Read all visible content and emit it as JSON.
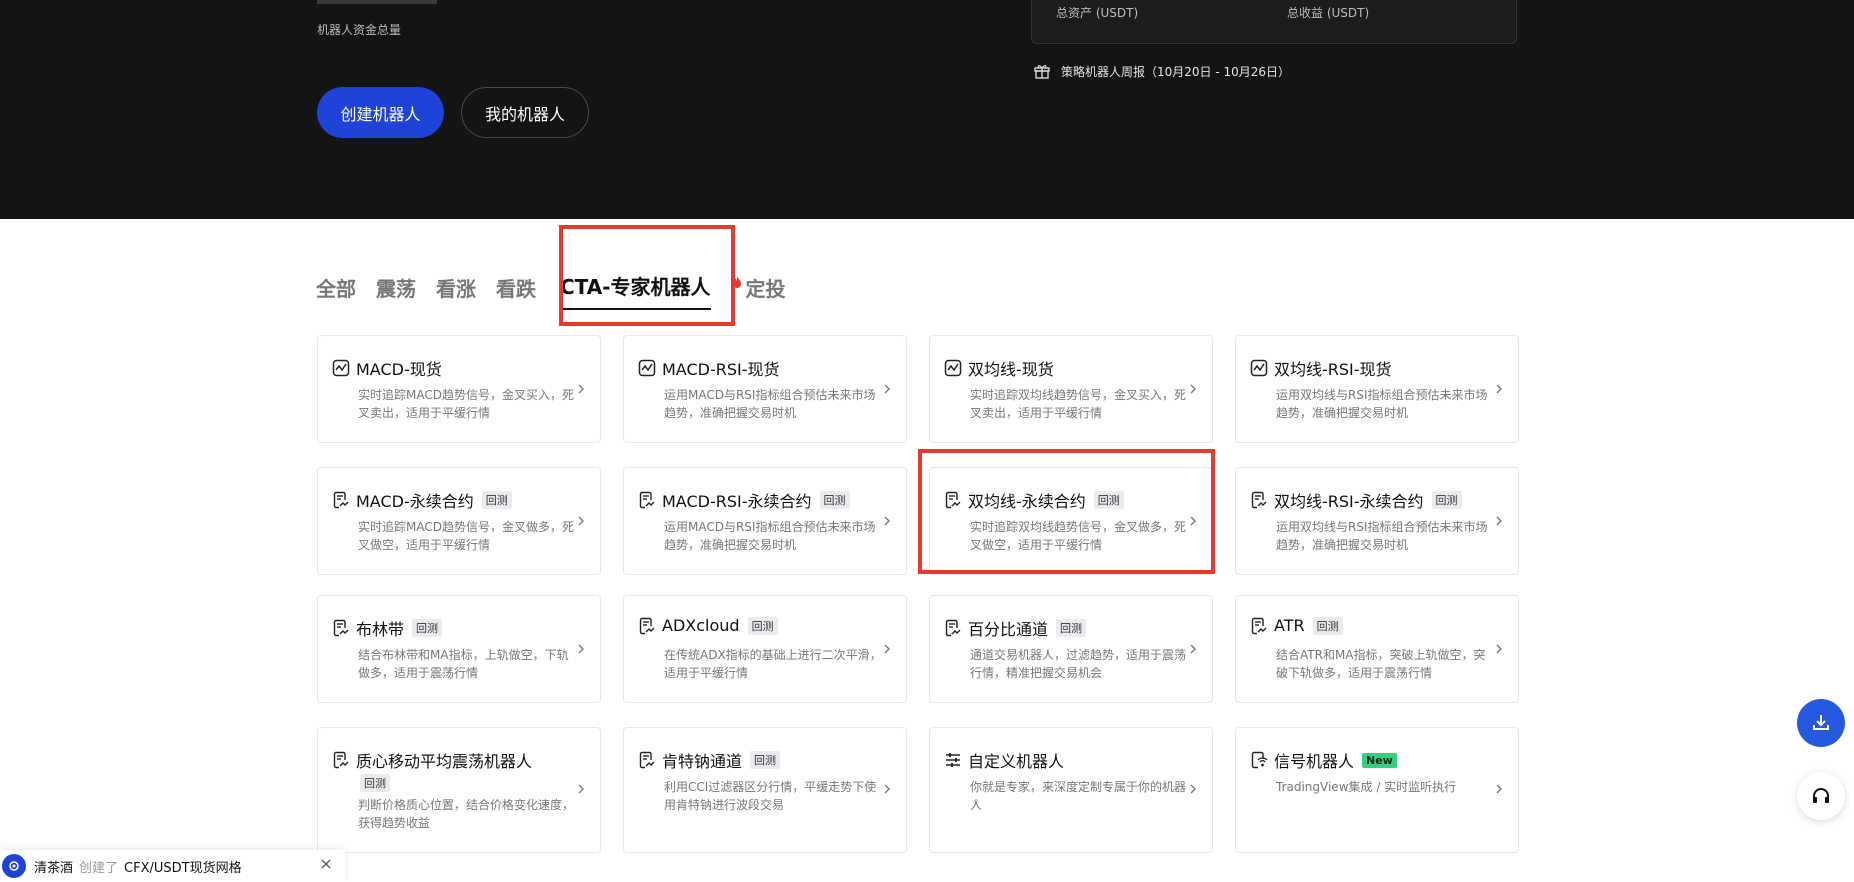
{
  "hero": {
    "label": "机器人资金总量",
    "create_button": "创建机器人",
    "my_bots_button": "我的机器人",
    "stats": {
      "total_assets_label": "总资产 (USDT)",
      "total_profit_label": "总收益 (USDT)"
    },
    "weekly_report": "策略机器人周报（10月20日 - 10月26日）"
  },
  "tabs": [
    {
      "label": "全部"
    },
    {
      "label": "震荡"
    },
    {
      "label": "看涨"
    },
    {
      "label": "看跌"
    },
    {
      "label": "CTA-专家机器人",
      "active": true
    },
    {
      "label": "定投",
      "icon": "fire-icon"
    }
  ],
  "cards": [
    {
      "title": "MACD-现货",
      "badge": "",
      "icon": "chart-line-icon",
      "desc": "实时追踪MACD趋势信号，金叉买入，死叉卖出，适用于平缓行情"
    },
    {
      "title": "MACD-RSI-现货",
      "badge": "",
      "icon": "chart-line-icon",
      "desc": "运用MACD与RSI指标组合预估未来市场趋势，准确把握交易时机"
    },
    {
      "title": "双均线-现货",
      "badge": "",
      "icon": "chart-line-icon",
      "desc": "实时追踪双均线趋势信号，金叉买入，死叉卖出，适用于平缓行情"
    },
    {
      "title": "双均线-RSI-现货",
      "badge": "",
      "icon": "chart-line-icon",
      "desc": "运用双均线与RSI指标组合预估未来市场趋势，准确把握交易时机"
    },
    {
      "title": "MACD-永续合约",
      "badge": "回测",
      "icon": "doc-chart-icon",
      "desc": "实时追踪MACD趋势信号，金叉做多，死叉做空，适用于平缓行情"
    },
    {
      "title": "MACD-RSI-永续合约",
      "badge": "回测",
      "icon": "doc-chart-icon",
      "desc": "运用MACD与RSI指标组合预估未来市场趋势，准确把握交易时机"
    },
    {
      "title": "双均线-永续合约",
      "badge": "回测",
      "icon": "doc-chart-icon",
      "desc": "实时追踪双均线趋势信号，金叉做多，死叉做空，适用于平缓行情"
    },
    {
      "title": "双均线-RSI-永续合约",
      "badge": "回测",
      "icon": "doc-chart-icon",
      "desc": "运用双均线与RSI指标组合预估未来市场趋势，准确把握交易时机"
    },
    {
      "title": "布林带",
      "badge": "回测",
      "icon": "doc-chart-icon",
      "desc": "结合布林带和MA指标，上轨做空，下轨做多，适用于震荡行情"
    },
    {
      "title": "ADXcloud",
      "badge": "回测",
      "icon": "doc-chart-icon",
      "desc": "在传统ADX指标的基础上进行二次平滑，适用于平缓行情"
    },
    {
      "title": "百分比通道",
      "badge": "回测",
      "icon": "doc-chart-icon",
      "desc": "通道交易机器人，过滤趋势，适用于震荡行情，精准把握交易机会"
    },
    {
      "title": "ATR",
      "badge": "回测",
      "icon": "doc-chart-icon",
      "desc": "结合ATR和MA指标，突破上轨做空，突破下轨做多，适用于震荡行情"
    },
    {
      "title": "质心移动平均震荡机器人",
      "badge": "回测",
      "icon": "doc-chart-icon",
      "desc": "判断价格质心位置，结合价格变化速度，获得趋势收益"
    },
    {
      "title": "肯特钠通道",
      "badge": "回测",
      "icon": "doc-chart-icon",
      "desc": "利用CCI过滤器区分行情，平缓走势下使用肯特钠进行波段交易"
    },
    {
      "title": "自定义机器人",
      "badge": "",
      "icon": "sliders-icon",
      "desc": "你就是专家，来深度定制专属于你的机器人"
    },
    {
      "title": "信号机器人",
      "badge": "New",
      "icon": "signal-icon",
      "desc": "TradingView集成 / 实时监听执行"
    }
  ],
  "toast": {
    "user": "清茶酒",
    "action": "创建了",
    "target": "CFX/USDT现货网格"
  },
  "colors": {
    "accent": "#1f43d6",
    "highlight": "#e53a2c",
    "new_badge": "#35d07f",
    "hero_bg": "#141414"
  }
}
